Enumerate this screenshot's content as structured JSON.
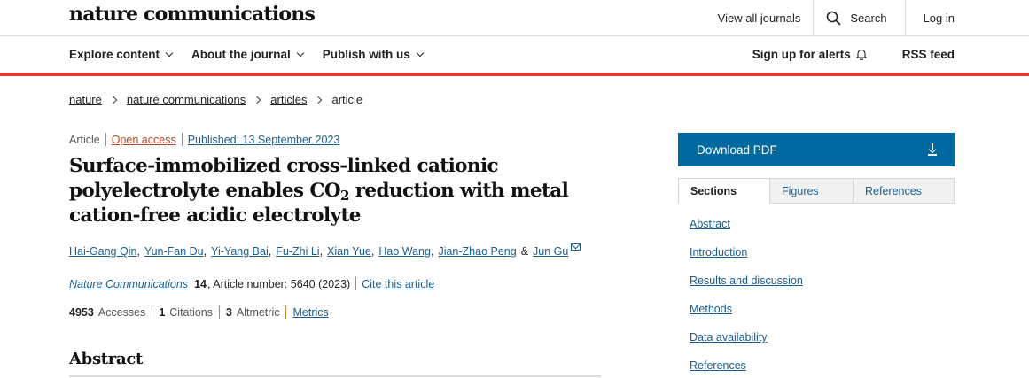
{
  "header": {
    "logo": "nature communications",
    "links": {
      "view_all": "View all journals",
      "search": "Search",
      "login": "Log in"
    }
  },
  "nav": {
    "left": [
      "Explore content",
      "About the journal",
      "Publish with us"
    ],
    "alerts": "Sign up for alerts",
    "rss": "RSS feed"
  },
  "breadcrumb": [
    "nature",
    "nature communications",
    "articles",
    "article"
  ],
  "article": {
    "type": "Article",
    "access": "Open access",
    "published": "Published: 13 September 2023",
    "title_part1": "Surface-immobilized cross-linked cationic polyelectrolyte enables CO",
    "title_sub": "2",
    "title_part2": " reduction with metal cation-free acidic electrolyte",
    "authors": [
      "Hai-Gang Qin",
      "Yun-Fan Du",
      "Yi-Yang Bai",
      "Fu-Zhi Li",
      "Xian Yue",
      "Hao Wang",
      "Jian-Zhao Peng"
    ],
    "amp": "&",
    "last_author": "Jun Gu",
    "journal": "Nature Communications",
    "volume": "14",
    "article_number": ", Article number: 5640 (2023)",
    "cite": "Cite this article",
    "metrics": {
      "accesses_value": "4953",
      "accesses_label": "Accesses",
      "citations_value": "1",
      "citations_label": "Citations",
      "altmetric_value": "3",
      "altmetric_label": "Altmetric",
      "metrics_link": "Metrics"
    },
    "abstract_heading": "Abstract"
  },
  "sidebar": {
    "download": "Download PDF",
    "tabs": [
      "Sections",
      "Figures",
      "References"
    ],
    "sections": [
      "Abstract",
      "Introduction",
      "Results and discussion",
      "Methods",
      "Data availability",
      "References"
    ]
  }
}
